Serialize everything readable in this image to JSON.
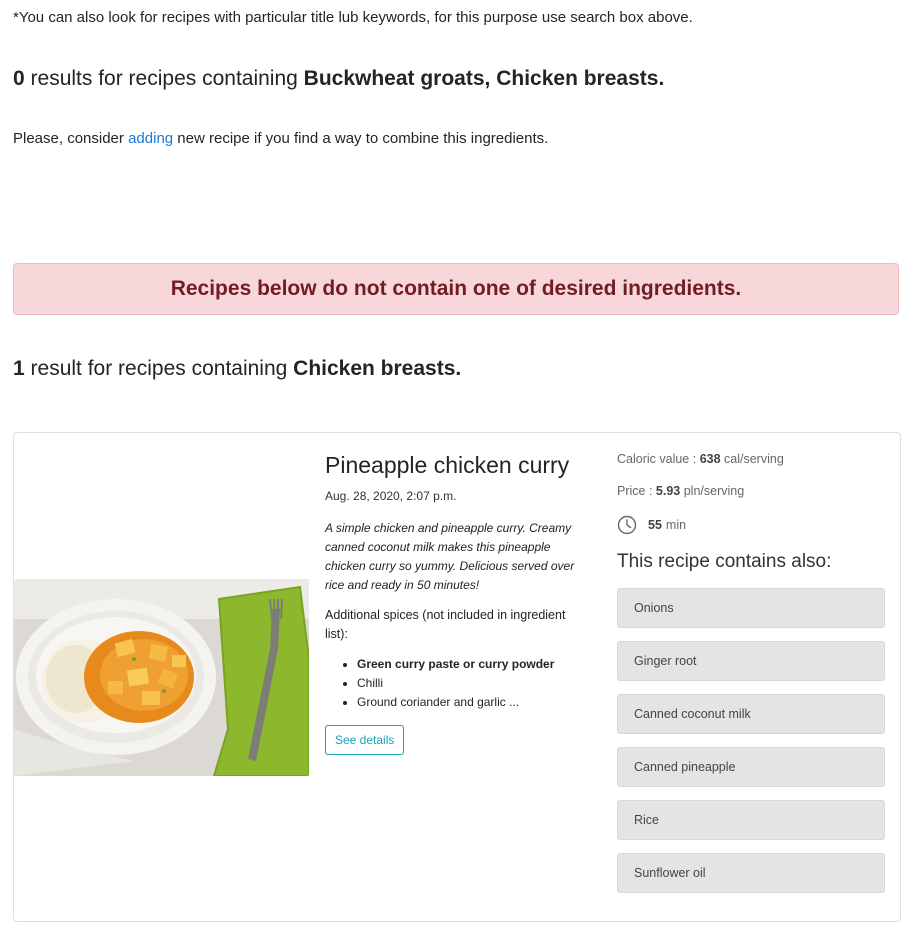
{
  "note": "*You can also look for recipes with particular title lub keywords, for this purpose use search box above.",
  "first_result": {
    "count": "0",
    "text": " results for recipes containing ",
    "ingredients": "Buckwheat groats, Chicken breasts."
  },
  "consider": {
    "before": "Please, consider ",
    "link": "adding",
    "after": " new recipe if you find a way to combine this ingredients."
  },
  "alert": "Recipes below do not contain one of desired ingredients.",
  "second_result": {
    "count": "1",
    "text": " result for recipes containing ",
    "ingredients": "Chicken breasts."
  },
  "recipe": {
    "title": "Pineapple chicken curry",
    "date": "Aug. 28, 2020, 2:07 p.m.",
    "description": "A simple chicken and pineapple curry. Creamy canned coconut milk makes this pineapple chicken curry so yummy. Delicious served over rice and ready in 50 minutes!",
    "spices_label": "Additional spices (not included in ingredient list):",
    "spices": [
      "Green curry paste or curry powder",
      "Chilli",
      "Ground coriander and garlic ..."
    ],
    "details_button": "See details",
    "caloric_label": "Caloric value : ",
    "caloric_value": "638",
    "caloric_unit": " cal/serving",
    "price_label": "Price : ",
    "price_value": "5.93",
    "price_unit": " pln/serving",
    "time_value": "55",
    "time_unit": "min",
    "contains_title": "This recipe contains also:",
    "ingredients": [
      "Onions",
      "Ginger root",
      "Canned coconut milk",
      "Canned pineapple",
      "Rice",
      "Sunflower oil"
    ]
  },
  "colors": {
    "link": "#1a7ad4",
    "alert_bg": "#f8d7da",
    "alert_text": "#721c24",
    "button_outline": "#17a2b8",
    "ingredient_bg": "#e3e4e5"
  },
  "icons": {
    "clock": "clock-icon"
  }
}
